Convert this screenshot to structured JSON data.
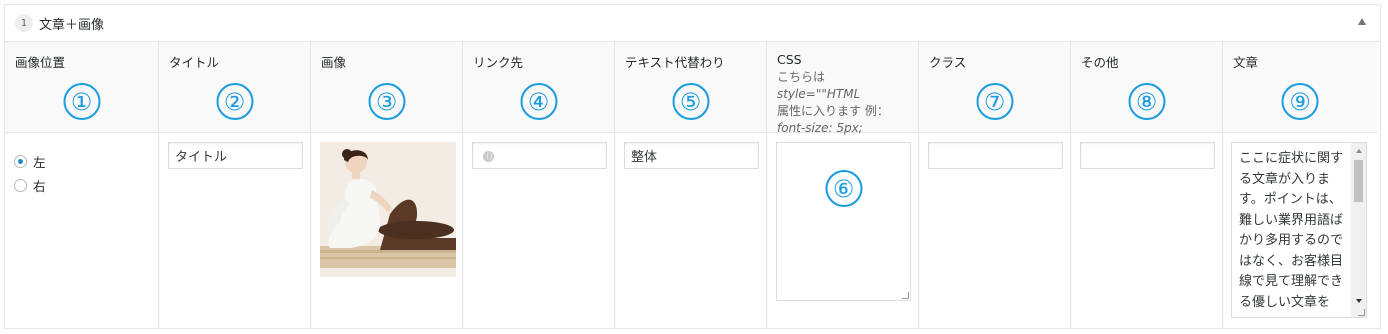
{
  "panel": {
    "index": "1",
    "title": "文章＋画像"
  },
  "columns": [
    {
      "label": "画像位置",
      "marker": "①"
    },
    {
      "label": "タイトル",
      "marker": "②"
    },
    {
      "label": "画像",
      "marker": "③"
    },
    {
      "label": "リンク先",
      "marker": "④"
    },
    {
      "label": "テキスト代替わり",
      "marker": "⑤"
    },
    {
      "label": "CSS",
      "note_prefix": "こちらは",
      "note_italic": "style=\"\"HTML",
      "note_rest": "属性に入ります 例：",
      "note_example": "font-size: 5px;",
      "marker": "⑥"
    },
    {
      "label": "クラス",
      "marker": "⑦"
    },
    {
      "label": "その他",
      "marker": "⑧"
    },
    {
      "label": "文章",
      "marker": "⑨"
    }
  ],
  "row": {
    "position_options": [
      {
        "label": "左",
        "selected": true
      },
      {
        "label": "右",
        "selected": false
      }
    ],
    "title_value": "タイトル",
    "image_alt": "整体",
    "link_value": "",
    "alt_text_value": "整体",
    "css_value": "",
    "class_value": "",
    "other_value": "",
    "article_text": "ここに症状に関する文章が入ります。ポイントは、難しい業界用語ばかり多用するのではなく、お客様目線で見て理解できる優しい文章を"
  },
  "colors": {
    "accent": "#1a9ce0",
    "radio_checked": "#1e8cbe",
    "header_bg": "#f9f9f9",
    "border": "#e5e5e5"
  },
  "icons": {
    "collapse": "triangle-up-icon",
    "link": "globe-icon"
  }
}
